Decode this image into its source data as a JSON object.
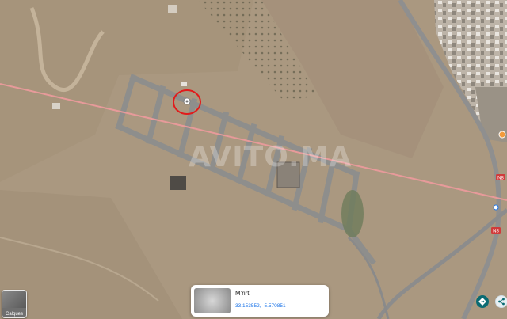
{
  "watermark": "AVITO.MA",
  "layers": {
    "label": "Calques"
  },
  "place": {
    "name": "M'rirt",
    "coordinates": "33.153552, -5.570851"
  },
  "icons": {
    "directions": "directions-icon",
    "share": "share-icon",
    "pin": "location-pin-icon"
  },
  "road_shields": [
    "N8",
    "N8"
  ],
  "colors": {
    "highlight_circle": "#e11b1b",
    "route_line": "#e79a9a",
    "direction_button": "#0b6b73",
    "link": "#1a73e8"
  }
}
